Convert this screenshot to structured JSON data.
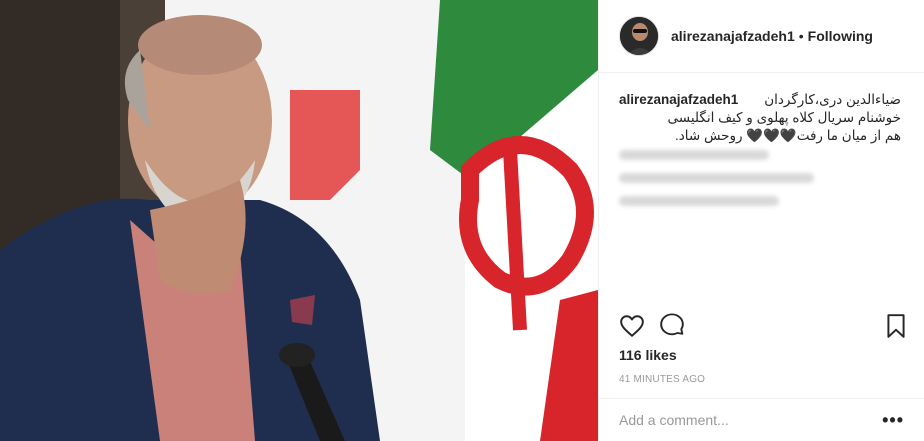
{
  "post": {
    "photo_alt": "Post photo",
    "username": "alirezanajafzadeh1",
    "separator": "•",
    "follow_state": "Following",
    "caption": {
      "username": "alirezanajafzadeh1",
      "line1": "ضیاءالدین دری،کارگردان",
      "line2": "خوشنام سریال کلاه پهلوی و کیف انگلیسی",
      "line3": "هم از میان ما رفت🖤🖤🖤 روحش شاد."
    },
    "likes": "116 likes",
    "timestamp": "41 MINUTES AGO",
    "comment": {
      "placeholder": "Add a comment..."
    },
    "more_options": "•••",
    "icons": {
      "like": "heart-icon",
      "comment": "comment-bubble-icon",
      "save": "bookmark-icon"
    }
  }
}
